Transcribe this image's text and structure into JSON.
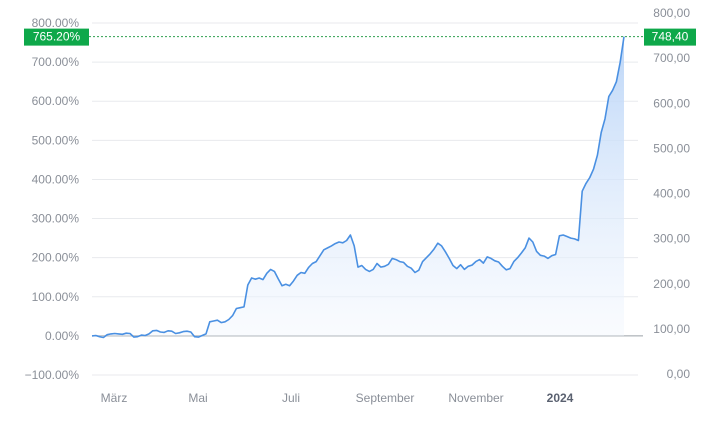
{
  "chart_data": {
    "type": "area",
    "x_ticks": [
      "März",
      "Mai",
      "Juli",
      "September",
      "November",
      "2024"
    ],
    "x_ticks_bold": [
      false,
      false,
      false,
      false,
      false,
      true
    ],
    "y_left_ticks": [
      "800.00%",
      "700.00%",
      "600.00%",
      "500.00%",
      "400.00%",
      "300.00%",
      "200.00%",
      "100.00%",
      "0.00%",
      "−100.00%"
    ],
    "y_left_values": [
      800,
      700,
      600,
      500,
      400,
      300,
      200,
      100,
      0,
      -100
    ],
    "y_right_ticks": [
      "800,00",
      "700,00",
      "600,00",
      "500,00",
      "400,00",
      "300,00",
      "200,00",
      "100,00",
      "0,00"
    ],
    "y_right_values": [
      800,
      700,
      600,
      500,
      400,
      300,
      200,
      100,
      0
    ],
    "ylim_percent": [
      -100,
      800
    ],
    "current_percent_label": "765.20%",
    "current_price_label": "748,40",
    "current_percent": 765.2,
    "current_price": 748.4,
    "grid": true,
    "colors": {
      "line": "#4a90e2",
      "fill_top": "#b9d4f7",
      "fill_bottom": "#f4f8fe",
      "badge": "#0ea84a",
      "dashed": "#2e9e4e",
      "zero_line": "#9aa0a6",
      "grid": "#e8eaed"
    },
    "series": [
      {
        "values": [
          0,
          1,
          -2,
          -4,
          3,
          5,
          6,
          5,
          4,
          7,
          6,
          -3,
          -2,
          2,
          1,
          5,
          13,
          14,
          10,
          9,
          13,
          12,
          6,
          8,
          11,
          12,
          10,
          -2,
          -3,
          1,
          5,
          36,
          38,
          40,
          34,
          36,
          42,
          52,
          70,
          72,
          74,
          130,
          148,
          145,
          148,
          144,
          160,
          170,
          165,
          146,
          128,
          132,
          128,
          140,
          155,
          162,
          160,
          175,
          185,
          190,
          205,
          220,
          225,
          230,
          236,
          240,
          238,
          244,
          258,
          230,
          176,
          180,
          170,
          165,
          170,
          185,
          176,
          178,
          183,
          198,
          195,
          190,
          188,
          178,
          173,
          162,
          168,
          190,
          200,
          210,
          222,
          237,
          230,
          215,
          198,
          180,
          172,
          182,
          170,
          178,
          181,
          190,
          195,
          186,
          202,
          198,
          192,
          189,
          178,
          169,
          172,
          190,
          200,
          212,
          225,
          250,
          240,
          216,
          206,
          204,
          198,
          205,
          208,
          256,
          258,
          254,
          250,
          248,
          244,
          370,
          390,
          405,
          427,
          462,
          520,
          555,
          612,
          628,
          650,
          700,
          765.2
        ]
      }
    ]
  }
}
